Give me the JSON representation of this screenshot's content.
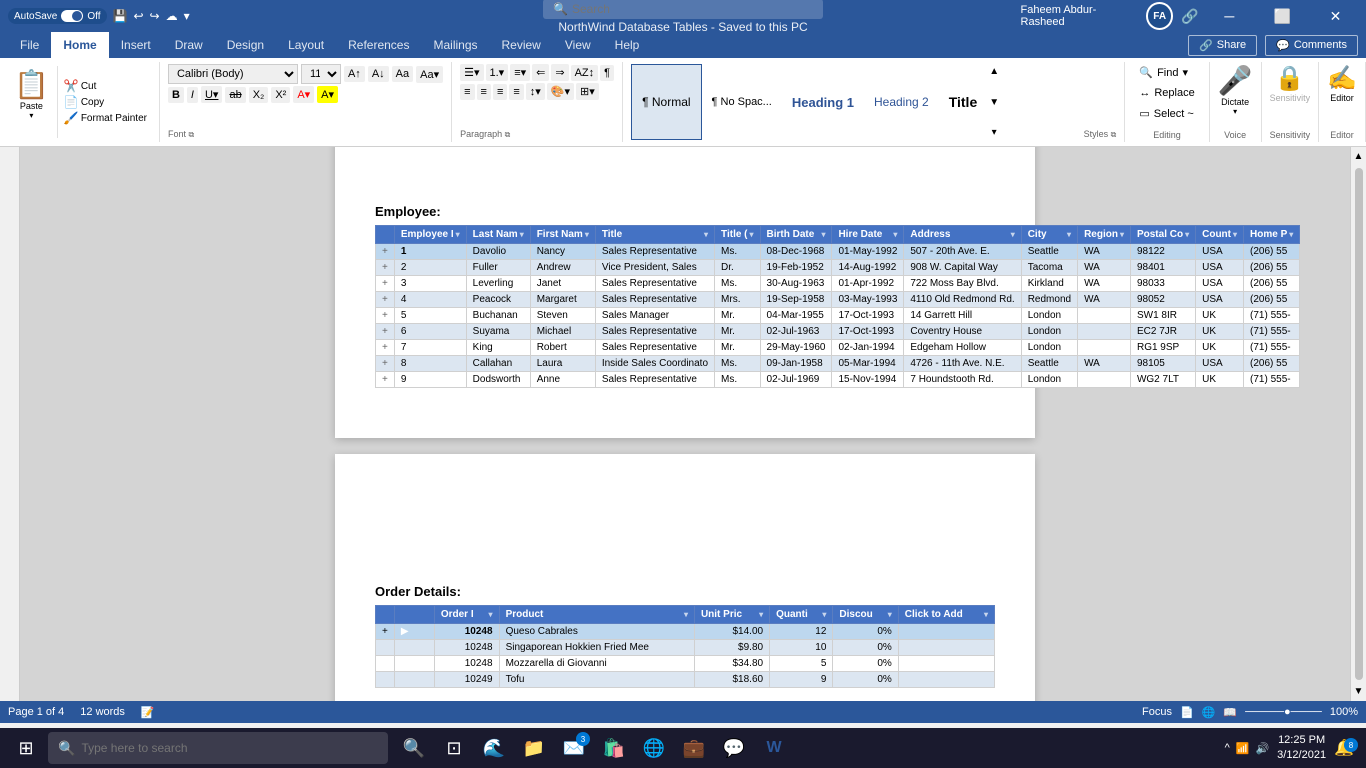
{
  "titlebar": {
    "autosave_label": "AutoSave",
    "autosave_state": "Off",
    "title": "NorthWind Database Tables - Saved to this PC",
    "search_placeholder": "Search",
    "user_name": "Faheem Abdur-Rasheed",
    "user_initials": "FA"
  },
  "ribbon": {
    "tabs": [
      "File",
      "Home",
      "Insert",
      "Draw",
      "Design",
      "Layout",
      "References",
      "Mailings",
      "Review",
      "View",
      "Help"
    ],
    "active_tab": "Home",
    "font": {
      "family": "Calibri (Body)",
      "size": "11",
      "grow_label": "A",
      "shrink_label": "A"
    },
    "styles": [
      {
        "label": "¶ Normal",
        "key": "normal",
        "active": true
      },
      {
        "label": "¶ No Spac...",
        "key": "nospace",
        "active": false
      },
      {
        "label": "Heading 1",
        "key": "h1",
        "active": false
      },
      {
        "label": "Heading 2",
        "key": "h2",
        "active": false
      },
      {
        "label": "Title",
        "key": "title",
        "active": false
      }
    ],
    "share_label": "Share",
    "comments_label": "Comments",
    "find_label": "Find",
    "replace_label": "Replace",
    "select_label": "Select ~"
  },
  "employee_table": {
    "section_label": "Employee:",
    "headers": [
      "Employee I",
      "Last Nam",
      "First Nam",
      "Title",
      "Title (",
      "Birth Date",
      "Hire Date",
      "Address",
      "City",
      "Region",
      "Postal Co",
      "Count",
      "Home P"
    ],
    "rows": [
      {
        "expand": "+",
        "id": "1",
        "last": "Davolio",
        "first": "Nancy",
        "title": "Sales Representative",
        "title_c": "Ms.",
        "birth": "08-Dec-1968",
        "hire": "01-May-1992",
        "address": "507 - 20th Ave. E.",
        "city": "Seattle",
        "region": "WA",
        "postal": "98122",
        "country": "USA",
        "phone": "(206) 55",
        "selected": true
      },
      {
        "expand": "+",
        "id": "2",
        "last": "Fuller",
        "first": "Andrew",
        "title": "Vice President, Sales",
        "title_c": "Dr.",
        "birth": "19-Feb-1952",
        "hire": "14-Aug-1992",
        "address": "908 W. Capital Way",
        "city": "Tacoma",
        "region": "WA",
        "postal": "98401",
        "country": "USA",
        "phone": "(206) 55",
        "selected": false
      },
      {
        "expand": "+",
        "id": "3",
        "last": "Leverling",
        "first": "Janet",
        "title": "Sales Representative",
        "title_c": "Ms.",
        "birth": "30-Aug-1963",
        "hire": "01-Apr-1992",
        "address": "722 Moss Bay Blvd.",
        "city": "Kirkland",
        "region": "WA",
        "postal": "98033",
        "country": "USA",
        "phone": "(206) 55",
        "selected": false
      },
      {
        "expand": "+",
        "id": "4",
        "last": "Peacock",
        "first": "Margaret",
        "title": "Sales Representative",
        "title_c": "Mrs.",
        "birth": "19-Sep-1958",
        "hire": "03-May-1993",
        "address": "4110 Old Redmond Rd.",
        "city": "Redmond",
        "region": "WA",
        "postal": "98052",
        "country": "USA",
        "phone": "(206) 55",
        "selected": false
      },
      {
        "expand": "+",
        "id": "5",
        "last": "Buchanan",
        "first": "Steven",
        "title": "Sales Manager",
        "title_c": "Mr.",
        "birth": "04-Mar-1955",
        "hire": "17-Oct-1993",
        "address": "14 Garrett Hill",
        "city": "London",
        "region": "",
        "postal": "SW1 8IR",
        "country": "UK",
        "phone": "(71) 555-",
        "selected": false
      },
      {
        "expand": "+",
        "id": "6",
        "last": "Suyama",
        "first": "Michael",
        "title": "Sales Representative",
        "title_c": "Mr.",
        "birth": "02-Jul-1963",
        "hire": "17-Oct-1993",
        "address": "Coventry House",
        "city": "London",
        "region": "",
        "postal": "EC2 7JR",
        "country": "UK",
        "phone": "(71) 555-",
        "selected": false
      },
      {
        "expand": "+",
        "id": "7",
        "last": "King",
        "first": "Robert",
        "title": "Sales Representative",
        "title_c": "Mr.",
        "birth": "29-May-1960",
        "hire": "02-Jan-1994",
        "address": "Edgeham Hollow",
        "city": "London",
        "region": "",
        "postal": "RG1 9SP",
        "country": "UK",
        "phone": "(71) 555-",
        "selected": false
      },
      {
        "expand": "+",
        "id": "8",
        "last": "Callahan",
        "first": "Laura",
        "title": "Inside Sales Coordinato",
        "title_c": "Ms.",
        "birth": "09-Jan-1958",
        "hire": "05-Mar-1994",
        "address": "4726 - 11th Ave. N.E.",
        "city": "Seattle",
        "region": "WA",
        "postal": "98105",
        "country": "USA",
        "phone": "(206) 55",
        "selected": false
      },
      {
        "expand": "+",
        "id": "9",
        "last": "Dodsworth",
        "first": "Anne",
        "title": "Sales Representative",
        "title_c": "Ms.",
        "birth": "02-Jul-1969",
        "hire": "15-Nov-1994",
        "address": "7 Houndstooth Rd.",
        "city": "London",
        "region": "",
        "postal": "WG2 7LT",
        "country": "UK",
        "phone": "(71) 555-",
        "selected": false
      }
    ]
  },
  "order_details_table": {
    "section_label": "Order Details:",
    "headers": [
      "Order I",
      "Product",
      "Unit Pric",
      "Quanti",
      "Discou",
      "Click to Add"
    ],
    "rows": [
      {
        "expand": "+",
        "order_id": "10248",
        "product": "Queso Cabrales",
        "unit_price": "$14.00",
        "quantity": "12",
        "discount": "0%",
        "selected": true
      },
      {
        "expand": "",
        "order_id": "10248",
        "product": "Singaporean Hokkien Fried Mee",
        "unit_price": "$9.80",
        "quantity": "10",
        "discount": "0%",
        "selected": false
      },
      {
        "expand": "",
        "order_id": "10248",
        "product": "Mozzarella di Giovanni",
        "unit_price": "$34.80",
        "quantity": "5",
        "discount": "0%",
        "selected": false
      },
      {
        "expand": "",
        "order_id": "10249",
        "product": "Tofu",
        "unit_price": "$18.60",
        "quantity": "9",
        "discount": "0%",
        "selected": false
      }
    ]
  },
  "statusbar": {
    "page_info": "Page 1 of 4",
    "word_count": "12 words",
    "focus_label": "Focus",
    "zoom_label": "100%"
  },
  "taskbar": {
    "search_placeholder": "Type here to search",
    "clock_time": "12:25 PM",
    "clock_date": "3/12/2021",
    "notification_badge": "8"
  }
}
